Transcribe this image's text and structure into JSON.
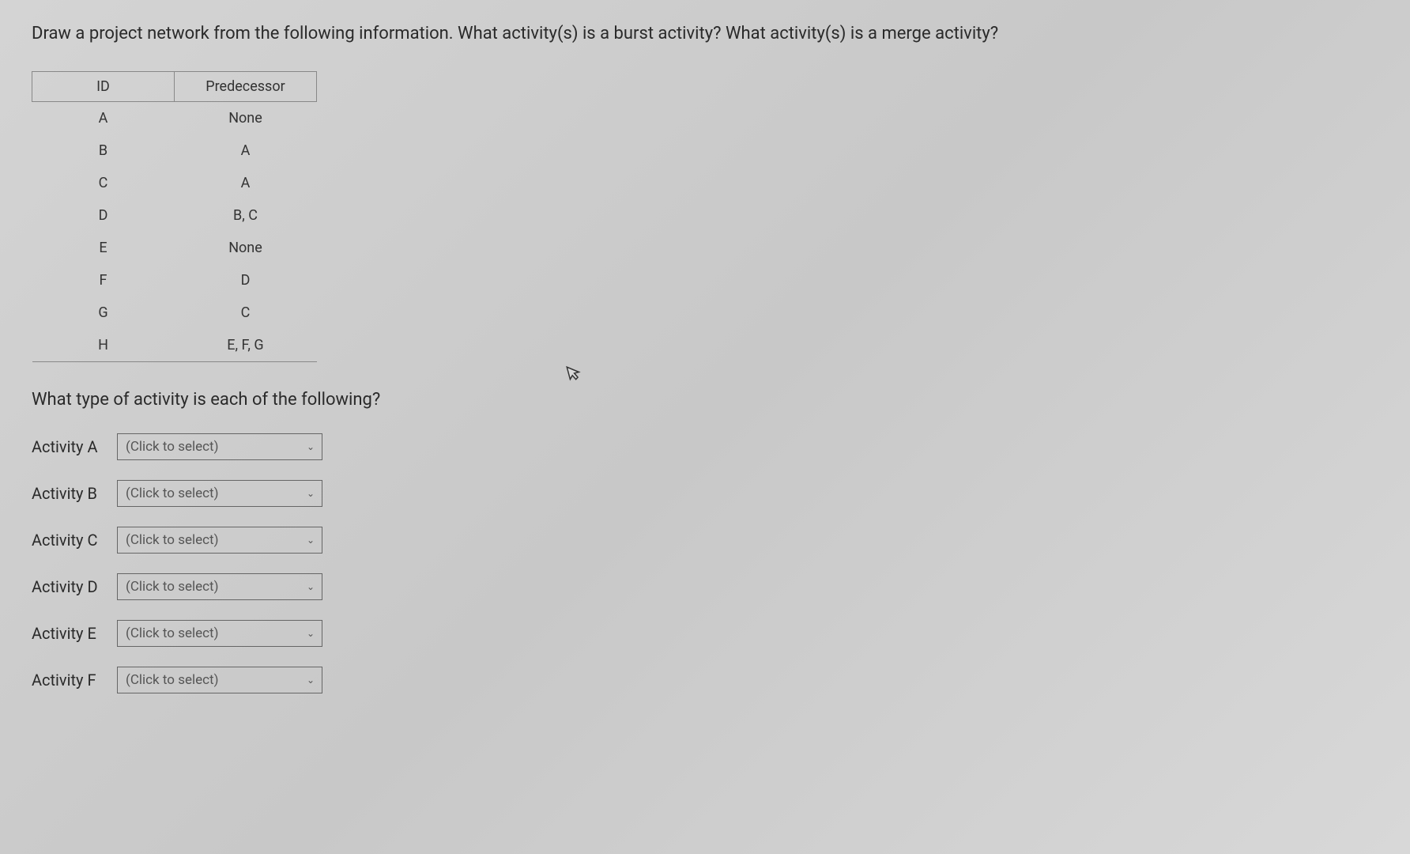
{
  "question": "Draw a project network from the following information. What activity(s) is a burst activity? What activity(s) is a merge activity?",
  "table": {
    "headers": {
      "id": "ID",
      "predecessor": "Predecessor"
    },
    "rows": [
      {
        "id": "A",
        "predecessor": "None"
      },
      {
        "id": "B",
        "predecessor": "A"
      },
      {
        "id": "C",
        "predecessor": "A"
      },
      {
        "id": "D",
        "predecessor": "B, C"
      },
      {
        "id": "E",
        "predecessor": "None"
      },
      {
        "id": "F",
        "predecessor": "D"
      },
      {
        "id": "G",
        "predecessor": "C"
      },
      {
        "id": "H",
        "predecessor": "E, F, G"
      }
    ]
  },
  "sub_question": "What type of activity is each of the following?",
  "activities": [
    {
      "label": "Activity A",
      "placeholder": "(Click to select)"
    },
    {
      "label": "Activity B",
      "placeholder": "(Click to select)"
    },
    {
      "label": "Activity C",
      "placeholder": "(Click to select)"
    },
    {
      "label": "Activity D",
      "placeholder": "(Click to select)"
    },
    {
      "label": "Activity E",
      "placeholder": "(Click to select)"
    },
    {
      "label": "Activity F",
      "placeholder": "(Click to select)"
    }
  ]
}
